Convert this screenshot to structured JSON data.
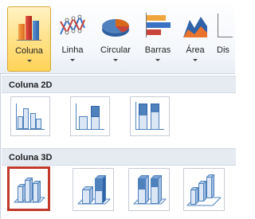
{
  "ribbon": {
    "buttons": [
      {
        "label": "Coluna",
        "icon": "column-chart-icon",
        "active": true
      },
      {
        "label": "Linha",
        "icon": "line-chart-icon",
        "active": false
      },
      {
        "label": "Circular",
        "icon": "pie-chart-icon",
        "active": false
      },
      {
        "label": "Barras",
        "icon": "bar-chart-icon",
        "active": false
      },
      {
        "label": "Área",
        "icon": "area-chart-icon",
        "active": false
      },
      {
        "label": "Dis",
        "icon": "scatter-chart-icon",
        "active": false
      }
    ]
  },
  "gallery": {
    "sections": [
      {
        "title": "Coluna 2D",
        "items": [
          "clustered-column-2d",
          "stacked-column-2d",
          "100-stacked-column-2d"
        ]
      },
      {
        "title": "Coluna 3D",
        "items": [
          "clustered-column-3d",
          "stacked-column-3d",
          "100-stacked-column-3d",
          "column-3d"
        ]
      }
    ],
    "selected_item": "clustered-column-3d"
  },
  "colors": {
    "active_button": "#ffd357",
    "selection_border": "#c0392b",
    "section_header": "#e6ebf2",
    "column_blue": "#4f81bd"
  }
}
